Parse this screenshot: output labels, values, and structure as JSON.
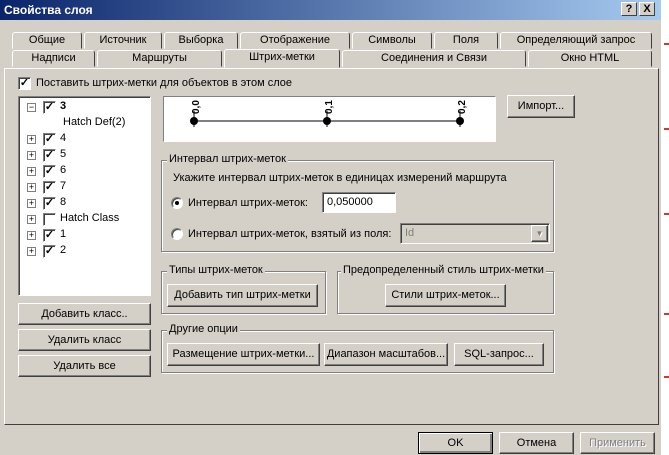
{
  "window": {
    "title": "Свойства слоя",
    "help_glyph": "?",
    "close_glyph": "X"
  },
  "tabs_row1": [
    {
      "label": "Общие"
    },
    {
      "label": "Источник"
    },
    {
      "label": "Выборка"
    },
    {
      "label": "Отображение"
    },
    {
      "label": "Символы"
    },
    {
      "label": "Поля"
    },
    {
      "label": "Определяющий запрос"
    }
  ],
  "tabs_row2": [
    {
      "label": "Надписи"
    },
    {
      "label": "Маршруты"
    },
    {
      "label": "Штрих-метки"
    },
    {
      "label": "Соединения и Связи"
    },
    {
      "label": "Окно HTML"
    }
  ],
  "active_tab": "Штрих-метки",
  "enable_checkbox": {
    "label": "Поставить штрих-метки для объектов в этом слое",
    "checked": true,
    "glyph": "✓"
  },
  "tree": {
    "items": [
      {
        "expander": "−",
        "checked": true,
        "label": "3",
        "bold": true
      },
      {
        "expander": "",
        "checked": null,
        "label": "Hatch Def(2)"
      },
      {
        "expander": "+",
        "checked": true,
        "label": "4"
      },
      {
        "expander": "+",
        "checked": true,
        "label": "5"
      },
      {
        "expander": "+",
        "checked": true,
        "label": "6"
      },
      {
        "expander": "+",
        "checked": true,
        "label": "7"
      },
      {
        "expander": "+",
        "checked": true,
        "label": "8"
      },
      {
        "expander": "+",
        "checked": false,
        "label": "Hatch Class"
      },
      {
        "expander": "+",
        "checked": true,
        "label": "1"
      },
      {
        "expander": "+",
        "checked": true,
        "label": "2"
      }
    ],
    "check_glyph": "✓"
  },
  "class_buttons": {
    "add": "Добавить класс..",
    "delete": "Удалить класс",
    "delete_all": "Удалить все"
  },
  "preview": {
    "ticks": [
      "0,0",
      "0,1",
      "0,2"
    ]
  },
  "import_button": "Импорт...",
  "interval_group": {
    "title": "Интервал штрих-меток",
    "description": "Укажите интервал штрих-меток в единицах измерений маршрута",
    "option_interval": {
      "label": "Интервал штрих-меток:",
      "selected": true,
      "value": "0,050000"
    },
    "option_field": {
      "label": "Интервал штрих-меток, взятый из поля:",
      "selected": false,
      "value": "Id",
      "arrow": "▼"
    }
  },
  "types_group": {
    "title": "Типы штрих-меток",
    "button": "Добавить тип штрих-метки"
  },
  "style_group": {
    "title": "Предопределенный стиль штрих-метки",
    "button": "Стили штрих-меток..."
  },
  "other_group": {
    "title": "Другие опции",
    "buttons": [
      "Размещение штрих-метки...",
      "Диапазон масштабов...",
      "SQL-запрос..."
    ]
  },
  "dialog_buttons": {
    "ok": "OK",
    "cancel": "Отмена",
    "apply": "Применить"
  },
  "colors": {
    "title_start": "#0a246a",
    "title_end": "#a6caf0",
    "face": "#d4d0c8",
    "side_marks": "#d03a2a"
  }
}
